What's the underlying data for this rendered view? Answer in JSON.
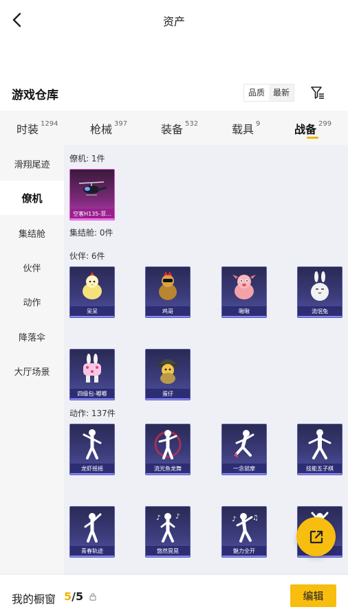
{
  "header": {
    "title": "资产"
  },
  "warehouse": {
    "title": "游戏仓库",
    "sort_options": [
      "品质",
      "最新"
    ]
  },
  "categories": [
    {
      "label": "时装",
      "count": "1294",
      "active": false
    },
    {
      "label": "枪械",
      "count": "397",
      "active": false
    },
    {
      "label": "装备",
      "count": "532",
      "active": false
    },
    {
      "label": "载具",
      "count": "9",
      "active": false
    },
    {
      "label": "战备",
      "count": "299",
      "active": true
    }
  ],
  "side_menu": [
    {
      "label": "滑翔尾迹",
      "active": false
    },
    {
      "label": "僚机",
      "active": true
    },
    {
      "label": "集结舱",
      "active": false
    },
    {
      "label": "伙伴",
      "active": false
    },
    {
      "label": "动作",
      "active": false
    },
    {
      "label": "降落伞",
      "active": false
    },
    {
      "label": "大厅场景",
      "active": false
    }
  ],
  "sections": {
    "wingman": {
      "title": "僚机: 1件",
      "items": [
        "空客H135-菲..."
      ]
    },
    "capsule": {
      "title": "集结舱: 0件"
    },
    "partner": {
      "title": "伙伴: 6件",
      "items": [
        "呆呆",
        "鸡哥",
        "啾啾",
        "流氓兔",
        "四级包-嘟嘟",
        "蛋仔"
      ]
    },
    "emote": {
      "title": "动作: 137件",
      "items": [
        "龙虾摇摇",
        "流光鱼龙舞",
        "一念就摩",
        "技能五子棋",
        "青春轨迹",
        "悠然晃晃",
        "魅力全开",
        ""
      ]
    }
  },
  "showcase": {
    "label": "我的橱窗",
    "current": "5",
    "separator": "/",
    "total": "5"
  },
  "edit_label": "编辑",
  "colors": {
    "accent": "#f7bd0f",
    "card_standard": "#3b3b7a",
    "card_purple": "#c23bb7"
  }
}
